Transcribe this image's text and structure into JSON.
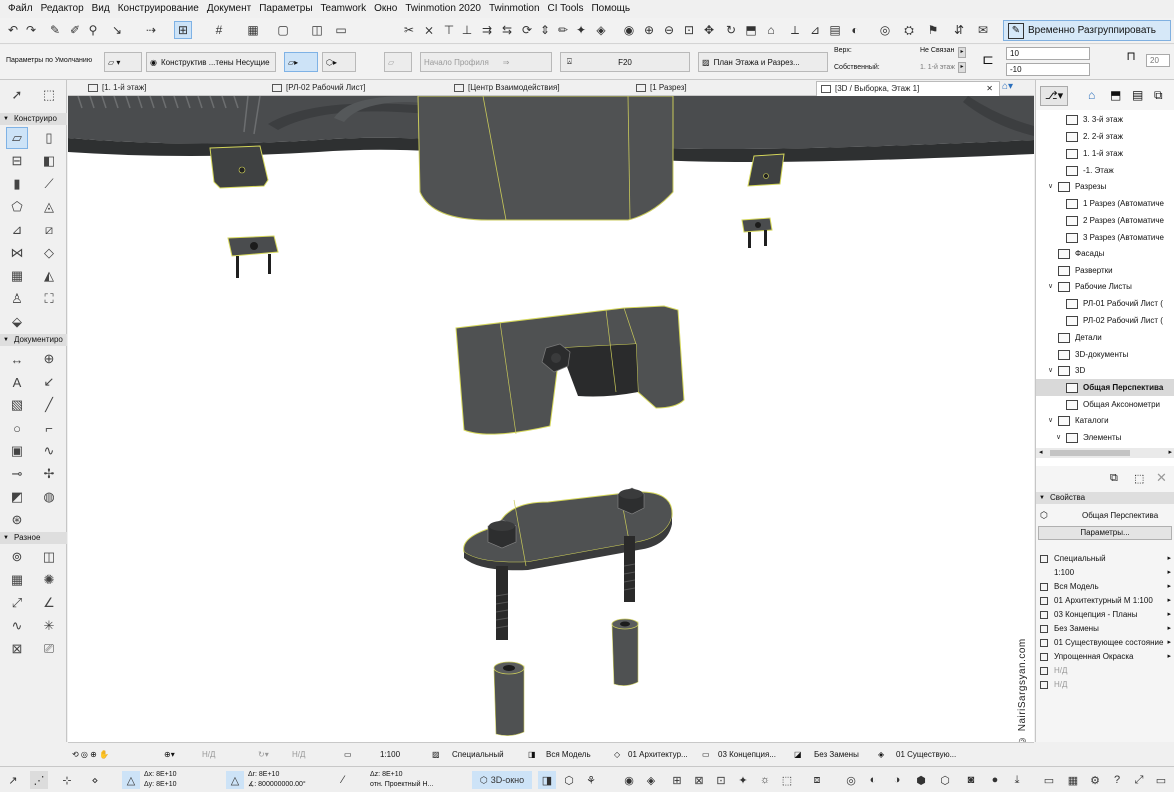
{
  "menu": [
    "Файл",
    "Редактор",
    "Вид",
    "Конструирование",
    "Документ",
    "Параметры",
    "Teamwork",
    "Окно",
    "Twinmotion 2020",
    "Twinmotion",
    "CI Tools",
    "Помощь"
  ],
  "regroup_label": "Временно Разгруппировать",
  "infobox": {
    "defaults_label": "Параметры по Умолчанию",
    "layer_label": "Конструктив ...тены Несущие",
    "profile_label": "Начало Профиля",
    "pen_label": "F20",
    "floorplan_label": "План Этажа и Разрез...",
    "top_label": "Верх:",
    "top_value": "Не Связан",
    "own_label": "Собственный:",
    "own_value": "1. 1-й этаж",
    "height_top": "10",
    "height_bottom": "-10",
    "side_value": "20"
  },
  "tabs": [
    "[1. 1-й этаж]",
    "[РЛ-02 Рабочий Лист]",
    "[Центр Взаимодействия]",
    "[1 Разрез]",
    "[3D / Выборка, Этаж 1]"
  ],
  "left_sections": [
    "Конструиро",
    "Документиро",
    "Разное"
  ],
  "navigator": {
    "items": [
      {
        "label": "3. 3-й этаж",
        "level": 3
      },
      {
        "label": "2. 2-й этаж",
        "level": 3
      },
      {
        "label": "1. 1-й этаж",
        "level": 3
      },
      {
        "label": "-1. Этаж",
        "level": 3
      },
      {
        "label": "Разрезы",
        "level": 1,
        "expand": true
      },
      {
        "label": "1 Разрез (Автоматиче",
        "level": 3
      },
      {
        "label": "2 Разрез (Автоматиче",
        "level": 3
      },
      {
        "label": "3 Разрез (Автоматиче",
        "level": 3
      },
      {
        "label": "Фасады",
        "level": 2
      },
      {
        "label": "Развертки",
        "level": 2
      },
      {
        "label": "Рабочие Листы",
        "level": 1,
        "expand": true
      },
      {
        "label": "РЛ-01 Рабочий Лист (",
        "level": 3
      },
      {
        "label": "РЛ-02 Рабочий Лист (",
        "level": 3
      },
      {
        "label": "Детали",
        "level": 2
      },
      {
        "label": "3D-документы",
        "level": 2
      },
      {
        "label": "3D",
        "level": 1,
        "expand": true
      },
      {
        "label": "Общая Перспектива",
        "level": 3,
        "selected": true
      },
      {
        "label": "Общая Аксонометри",
        "level": 3
      },
      {
        "label": "Каталоги",
        "level": 1,
        "expand": true
      },
      {
        "label": "Элементы",
        "level": 2,
        "expand": true
      }
    ]
  },
  "properties": {
    "header": "Свойства",
    "name": "Общая Перспектива",
    "button": "Параметры...",
    "rows": [
      "Специальный",
      "1:100",
      "Вся Модель",
      "01 Архитектурный М 1:100",
      "03 Концепция - Планы",
      "Без Замены",
      "01 Существующее состояние",
      "Упрощенная Окраска",
      "Н/Д",
      "Н/Д"
    ]
  },
  "status": {
    "nd1": "Н/Д",
    "nd2": "Н/Д",
    "scale": "1:100",
    "pen": "Специальный",
    "model": "Вся Модель",
    "layers": "01 Архитектур...",
    "concept": "03 Концепция...",
    "override": "Без Замены",
    "phase": "01 Существую..."
  },
  "coords": {
    "dx": "Δx: 8E+10",
    "dy": "Δy: 8E+10",
    "dr": "Δr: 8E+10",
    "da": "∡: 800000000.00°",
    "dz": "Δz: 8E+10",
    "ref": "отн. Проектный Н..."
  },
  "bottom_3d": "3D-окно",
  "watermark": "© NairiSargsyan.com",
  "colors": {
    "accent": "#cde3f7",
    "model": "#4f5152",
    "edge": "#d4d65a"
  }
}
